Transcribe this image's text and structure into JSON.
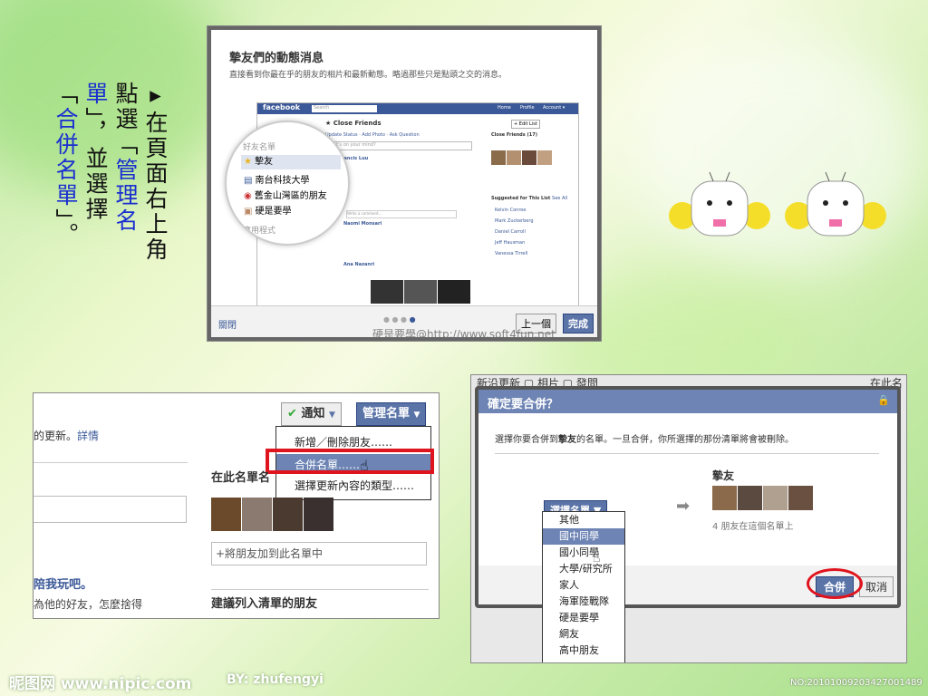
{
  "instruction": {
    "col1": "▸在頁面右上角",
    "col2a": "點選「",
    "col2b": "管理名",
    "col3a": "單",
    "col3b": "」，並選擇",
    "col4a": "「",
    "col4b": "合併名單",
    "col4c": "」。"
  },
  "dialog1": {
    "title": "摯友們的動態消息",
    "subtitle": "直接看到你最在乎的朋友的相片和最新動態。略過那些只是點頭之交的消息。",
    "fb_logo": "facebook",
    "search": "Search",
    "nav": [
      "Home",
      "Profile",
      "Account ▾"
    ],
    "list_title": "Close Friends",
    "actions": [
      "Update Status",
      "Add Photo",
      "Ask Question"
    ],
    "composer": "What's on your mind?",
    "sidebar_header": "Close Friends (17)",
    "suggested_header": "Suggested for This List",
    "suggested_see_all": "See All",
    "suggested": [
      "Kelvin Conroe",
      "Mark Zuckerberg",
      "Daniel Carroll",
      "Jeff Hausman",
      "Vanessa Tirrell"
    ],
    "post1_name": "Francis Luu",
    "post2_name": "Naomi Monsari",
    "post3_name": "Ana Nazanri",
    "add_list": "+ Edit List",
    "comment": "Write a comment...",
    "zoom_header": "好友名單",
    "zoom_items": [
      "摯友",
      "南台科技大學",
      "舊金山灣區的朋友",
      "硬是要學"
    ],
    "zoom_footer": "應用程式",
    "close_link": "關閉",
    "prev_button": "上一個",
    "done_button": "完成",
    "watermark": "硬是要學@http://www.soft4fun.net"
  },
  "panel2": {
    "left_text1": "的更新。",
    "left_link": "詳情",
    "notify_button": "通知",
    "manage_button": "管理名單",
    "menu": [
      "新增／刪除朋友……",
      "合併名單……",
      "選擇更新內容的類型……"
    ],
    "list_header": "在此名單名",
    "add_friend_placeholder": "+將朋友加到此名單中",
    "suggest_header": "建議列入清單的朋友",
    "left_bold": "陪我玩吧。",
    "left_body1": "為他的好友，怎麼捨得",
    "left_body2": "……"
  },
  "dialog3": {
    "bg_text": "新沿更新 ▢ 相片 ▢ 發問",
    "bg_text_right": "在此名",
    "title": "確定要合併？",
    "description_pre": "選擇你要合併到",
    "description_bold": "摯友",
    "description_post": "的名單。一旦合併，你所選擇的那份清單將會被刪除。",
    "select_button": "選擇名單 ▼",
    "target_list": "摯友",
    "target_count": "4 朋友在這個名單上",
    "options": [
      "其他",
      "國中同學",
      "國小同學",
      "大學/研究所",
      "家人",
      "海軍陸戰隊",
      "硬是要學",
      "網友",
      "高中朋友"
    ],
    "selected_option": "國中同學",
    "merge_button": "合併",
    "cancel_button": "取消"
  },
  "footer": {
    "logo": "昵图网 www.nipic.com",
    "author": "BY: zhufengyi",
    "id": "NO:20101009203427001489"
  },
  "colors": {
    "fb_blue": "#3b5998",
    "highlight_red": "#e0141e",
    "accent": "#6d84b4"
  }
}
